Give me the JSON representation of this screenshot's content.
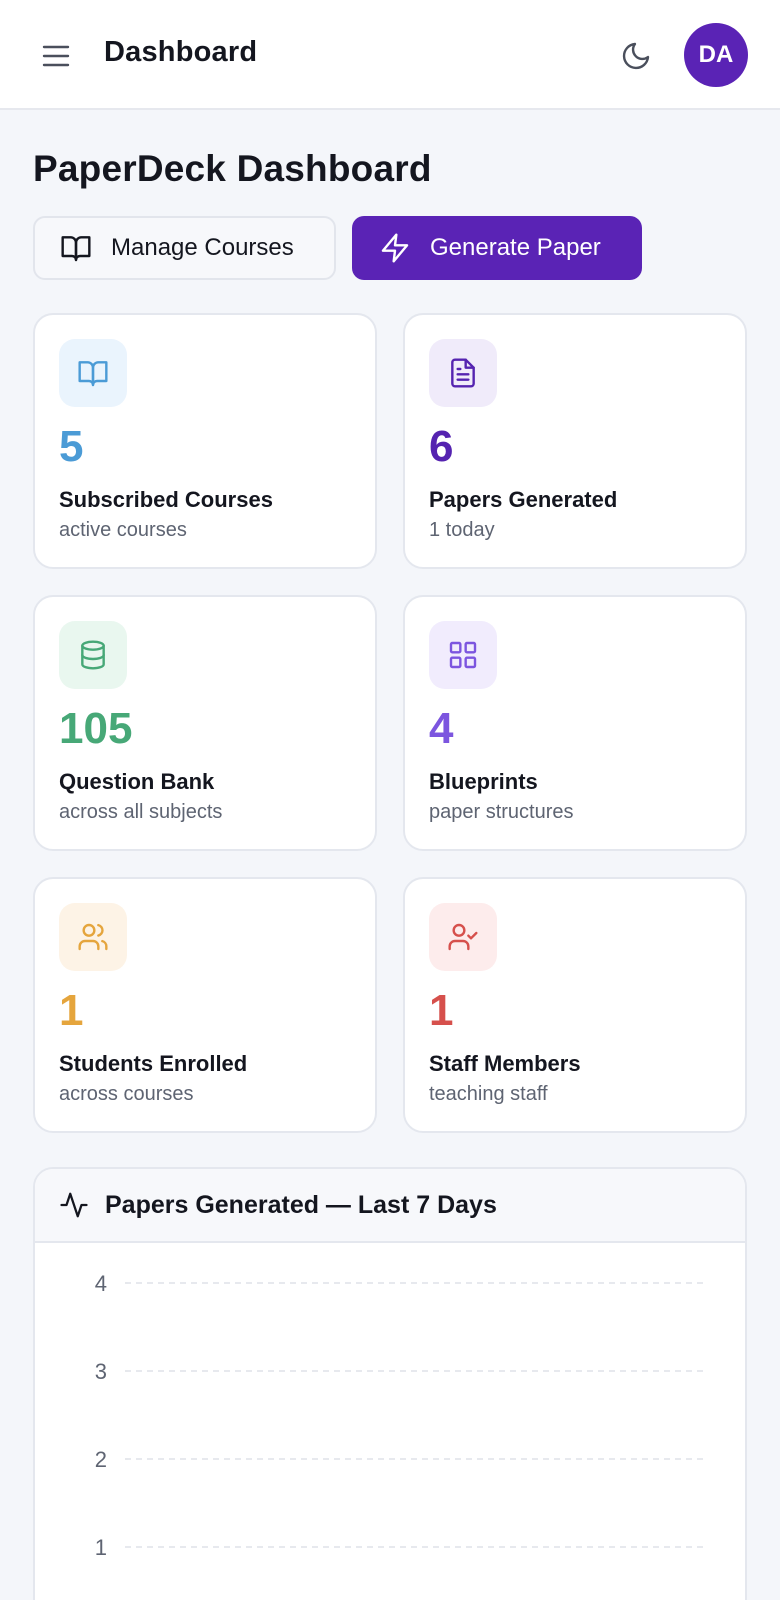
{
  "topbar": {
    "title": "Dashboard",
    "avatar_initials": "DA"
  },
  "page": {
    "title": "PaperDeck Dashboard"
  },
  "actions": {
    "manage_courses": "Manage Courses",
    "generate_paper": "Generate Paper"
  },
  "colors": {
    "brand": "#5a23b5",
    "blue": "#4b9bd6",
    "purple": "#5523b0",
    "green": "#47a877",
    "violet": "#7c55df",
    "orange": "#e5a53d",
    "red": "#d6504c"
  },
  "stats": [
    {
      "value": "5",
      "label": "Subscribed Courses",
      "sub": "active courses",
      "icon": "book-open-icon"
    },
    {
      "value": "6",
      "label": "Papers Generated",
      "sub": "1 today",
      "icon": "file-text-icon"
    },
    {
      "value": "105",
      "label": "Question Bank",
      "sub": "across all subjects",
      "icon": "database-icon"
    },
    {
      "value": "4",
      "label": "Blueprints",
      "sub": "paper structures",
      "icon": "grid-icon"
    },
    {
      "value": "1",
      "label": "Students Enrolled",
      "sub": "across courses",
      "icon": "users-icon"
    },
    {
      "value": "1",
      "label": "Staff Members",
      "sub": "teaching staff",
      "icon": "user-check-icon"
    }
  ],
  "chart": {
    "title": "Papers Generated — Last 7 Days"
  },
  "chart_data": {
    "type": "line",
    "title": "Papers Generated — Last 7 Days",
    "y_ticks": [
      4,
      3,
      2,
      1
    ],
    "ylim_visible": [
      1,
      4
    ],
    "grid": "dashed horizontal"
  }
}
